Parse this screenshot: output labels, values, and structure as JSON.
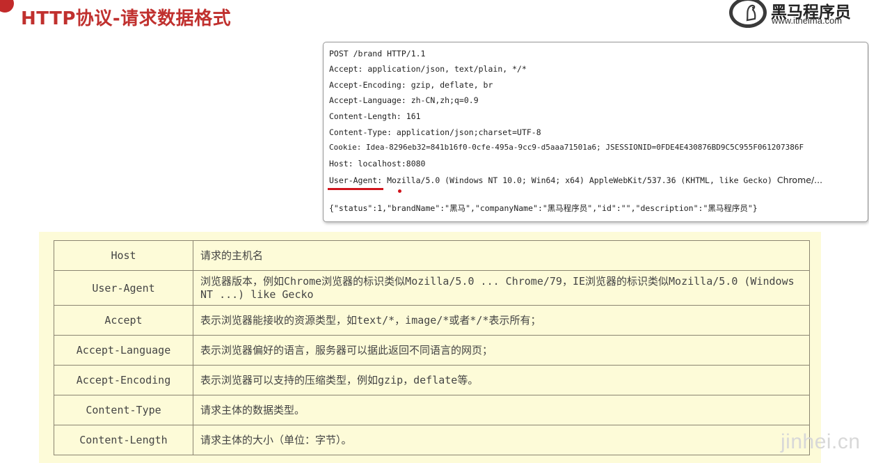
{
  "page": {
    "title": "HTTP协议-请求数据格式"
  },
  "logo": {
    "name": "黑马程序员",
    "url": "www.itheima.com",
    "icon": "horse-logo-icon"
  },
  "request": {
    "lines": [
      "POST /brand HTTP/1.1",
      "Accept: application/json, text/plain, */*",
      "Accept-Encoding: gzip, deflate, br",
      "Accept-Language: zh-CN,zh;q=0.9",
      "Content-Length: 161",
      "Content-Type: application/json;charset=UTF-8",
      "Cookie: Idea-8296eb32=841b16f0-0cfe-495a-9cc9-d5aaa71501a6; JSESSIONID=0FDE4E430876BD9C5C955F061207386F",
      "Host: localhost:8080",
      "User-Agent: Mozilla/5.0 (Windows NT 10.0; Win64; x64) AppleWebKit/537.36 (KHTML, like Gecko)"
    ],
    "ua_tail": "Chrome/...",
    "body": "{\"status\":1,\"brandName\":\"黑马\",\"companyName\":\"黑马程序员\",\"id\":\"\",\"description\":\"黑马程序员\"}",
    "highlight_color": "#d0141c"
  },
  "headers_table": {
    "rows": [
      {
        "name": "Host",
        "desc": "请求的主机名"
      },
      {
        "name": "User-Agent",
        "desc": "浏览器版本，例如Chrome浏览器的标识类似Mozilla/5.0 ... Chrome/79，IE浏览器的标识类似Mozilla/5.0 (Windows NT ...) like Gecko"
      },
      {
        "name": "Accept",
        "desc": "表示浏览器能接收的资源类型，如text/*，image/*或者*/*表示所有；"
      },
      {
        "name": "Accept-Language",
        "desc": "表示浏览器偏好的语言，服务器可以据此返回不同语言的网页；"
      },
      {
        "name": "Accept-Encoding",
        "desc": "表示浏览器可以支持的压缩类型，例如gzip，deflate等。"
      },
      {
        "name": "Content-Type",
        "desc": "请求主体的数据类型。"
      },
      {
        "name": "Content-Length",
        "desc": "请求主体的大小（单位：字节）。"
      }
    ]
  },
  "watermark": "jinhei.cn"
}
